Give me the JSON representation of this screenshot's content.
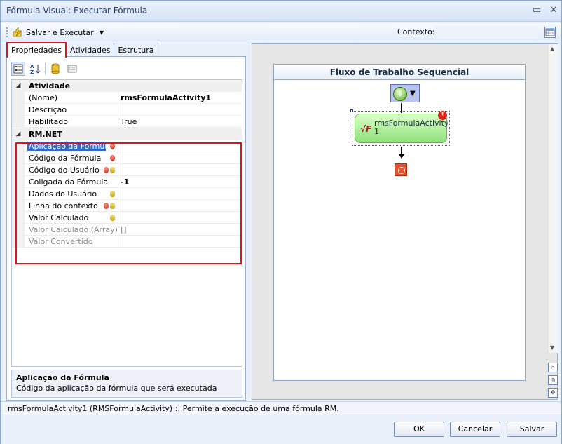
{
  "window": {
    "title": "Fórmula Visual: Executar Fórmula"
  },
  "toolbar": {
    "run_label": "Salvar e Executar",
    "context_label": "Contexto:",
    "context_value": ""
  },
  "tabs": [
    {
      "label": "Propriedades",
      "active": true
    },
    {
      "label": "Atividades",
      "active": false
    },
    {
      "label": "Estrutura",
      "active": false
    }
  ],
  "properties": {
    "categories": [
      {
        "name": "Atividade",
        "rows": [
          {
            "name": "(Nome)",
            "value": "rmsFormulaActivity1",
            "bold": true
          },
          {
            "name": "Descrição",
            "value": ""
          },
          {
            "name": "Habilitado",
            "value": "True"
          }
        ]
      },
      {
        "name": "RM.NET",
        "rows": [
          {
            "name": "Aplicação da Fórmula",
            "value": "",
            "icons": [
              "error"
            ],
            "selected": true
          },
          {
            "name": "Código da Fórmula",
            "value": "",
            "icons": [
              "error"
            ]
          },
          {
            "name": "Código do Usuário",
            "value": "",
            "icons": [
              "error",
              "database"
            ]
          },
          {
            "name": "Coligada da Fórmula",
            "value": "-1",
            "bold": true
          },
          {
            "name": "Dados do Usuário",
            "value": "",
            "icons": [
              "database"
            ]
          },
          {
            "name": "Linha do contexto",
            "value": "",
            "icons": [
              "error",
              "database"
            ]
          },
          {
            "name": "Valor Calculado",
            "value": "",
            "icons": [
              "database"
            ]
          },
          {
            "name": "Valor Calculado (Array)",
            "value": "[]",
            "disabled": true
          },
          {
            "name": "Valor Convertido",
            "value": "",
            "disabled": true
          }
        ]
      }
    ]
  },
  "description": {
    "title": "Aplicação da Fórmula",
    "text": "Código da aplicação da fórmula que será executada"
  },
  "designer": {
    "header": "Fluxo de Trabalho Sequencial",
    "activity_label_line1": "rmsFormulaActivity",
    "activity_label_line2": "1"
  },
  "status_bar": {
    "text": "rmsFormulaActivity1  (RMSFormulaActivity)  :: Permite a execução de uma fórmula RM."
  },
  "buttons": {
    "ok": "OK",
    "cancel": "Cancelar",
    "save": "Salvar"
  },
  "colors": {
    "highlight_border": "#e0141c",
    "selection": "#3169c6",
    "activity_fill": "#8ee07a"
  }
}
